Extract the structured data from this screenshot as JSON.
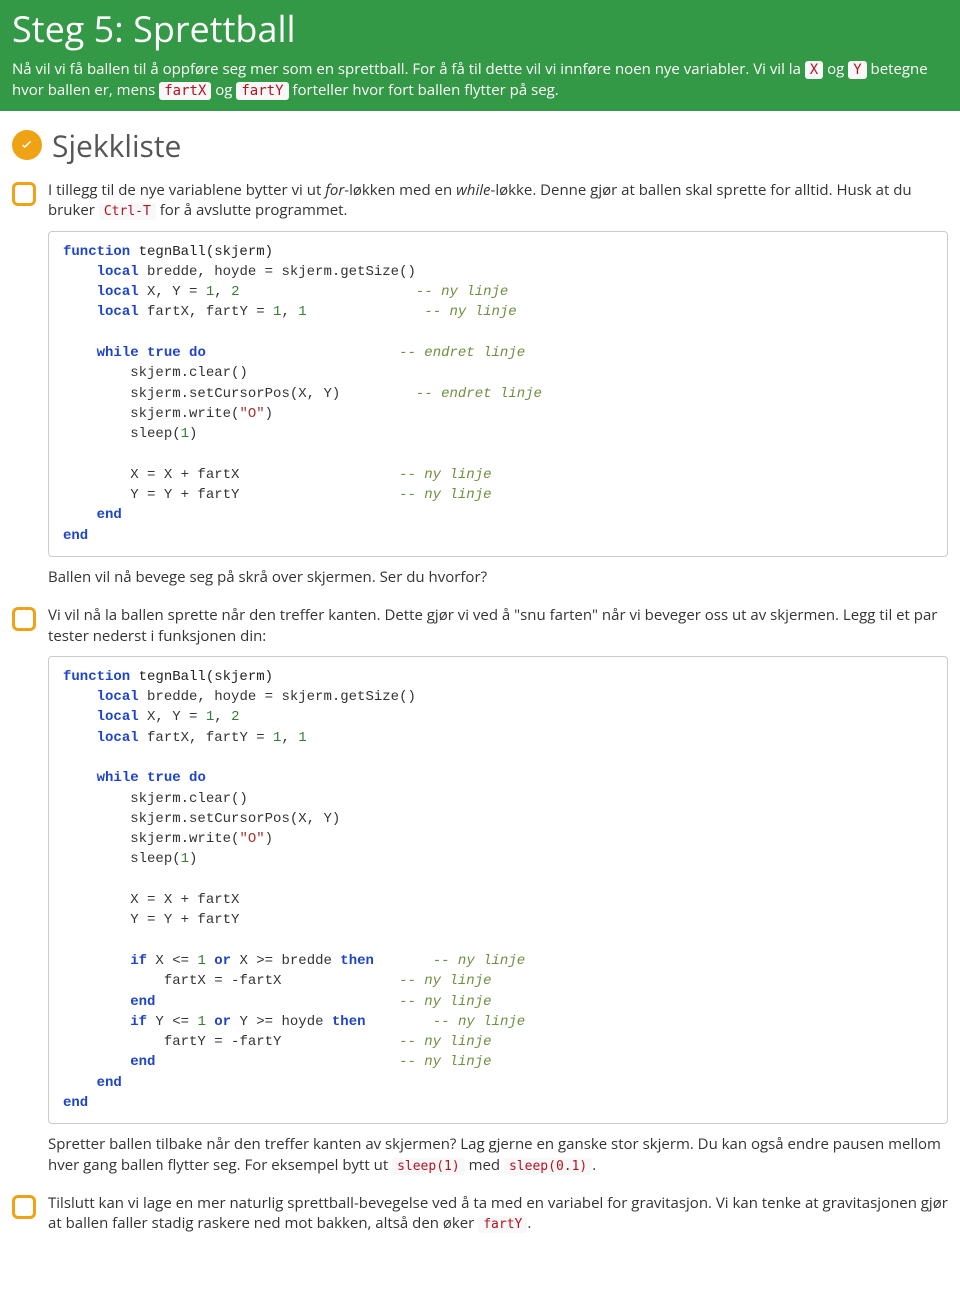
{
  "header": {
    "title": "Steg 5: Sprettball",
    "intro_parts": {
      "p1": "Nå vil vi få ballen til å oppføre seg mer som en sprettball. For å få til dette vil vi innføre noen nye variabler. Vi vil la ",
      "c1": "X",
      "p2": " og ",
      "c2": "Y",
      "p3": " betegne hvor ballen er, mens ",
      "c3": "fartX",
      "p4": " og ",
      "c4": "fartY",
      "p5": " forteller hvor fort ballen flytter på seg."
    }
  },
  "section": {
    "title": "Sjekkliste"
  },
  "item1": {
    "text_parts": {
      "p1": "I tillegg til de nye variablene bytter vi ut ",
      "i1": "for",
      "p2": "-løkken med en ",
      "i2": "while",
      "p3": "-løkke. Denne gjør at ballen skal sprette for alltid. Husk at du bruker ",
      "c1": "Ctrl-T",
      "p4": " for å avslutte programmet."
    },
    "followup": "Ballen vil nå bevege seg på skrå over skjermen. Ser du hvorfor?"
  },
  "item2": {
    "text": "Vi vil nå la ballen sprette når den treffer kanten. Dette gjør vi ved å \"snu farten\" når vi beveger oss ut av skjermen. Legg til et par tester nederst i funksjonen din:",
    "followup_parts": {
      "p1": "Spretter ballen tilbake når den treffer kanten av skjermen? Lag gjerne en ganske stor skjerm. Du kan også endre pausen mellom hver gang ballen flytter seg. For eksempel bytt ut ",
      "c1": "sleep(1)",
      "p2": " med ",
      "c2": "sleep(0.1)",
      "p3": "."
    }
  },
  "item3": {
    "text_parts": {
      "p1": "Tilslutt kan vi lage en mer naturlig sprettball-bevegelse ved å ta med en variabel for gravitasjon. Vi kan tenke at gravitasjonen gjør at ballen faller stadig raskere ned mot bakken, altså den øker ",
      "c1": "fartY",
      "p2": "."
    }
  },
  "code1": {
    "tokens": {
      "kw_function": "function",
      "fn_name": " tegnBall(skjerm)",
      "kw_local1": "local",
      "r1": " bredde, hoyde = skjerm.getSize()",
      "kw_local2": "local",
      "r2a": " X, Y = ",
      "n1": "1",
      "comma1": ", ",
      "n2": "2",
      "c_ny1": "-- ny linje",
      "kw_local3": "local",
      "r3a": " fartX, fartY = ",
      "n3": "1",
      "comma2": ", ",
      "n4": "1",
      "c_ny2": "-- ny linje",
      "kw_while": "while",
      "kw_true": "true",
      "kw_do": "do",
      "c_endret1": "-- endret linje",
      "l_clear": "skjerm.clear()",
      "l_setcur": "skjerm.setCursorPos(X, Y)",
      "c_endret2": "-- endret linje",
      "l_write_a": "skjerm.write(",
      "s_o": "\"O\"",
      "l_write_b": ")",
      "l_sleep_a": "sleep(",
      "n_sleep": "1",
      "l_sleep_b": ")",
      "l_xx": "X = X + fartX",
      "c_ny3": "-- ny linje",
      "l_yy": "Y = Y + fartY",
      "c_ny4": "-- ny linje",
      "kw_end1": "end",
      "kw_end2": "end"
    }
  },
  "code2": {
    "tokens": {
      "kw_function": "function",
      "fn_name": " tegnBall(skjerm)",
      "kw_local1": "local",
      "r1": " bredde, hoyde = skjerm.getSize()",
      "kw_local2": "local",
      "r2a": " X, Y = ",
      "n1": "1",
      "comma1": ", ",
      "n2": "2",
      "kw_local3": "local",
      "r3a": " fartX, fartY = ",
      "n3": "1",
      "comma2": ", ",
      "n4": "1",
      "kw_while": "while",
      "kw_true": "true",
      "kw_do": "do",
      "l_clear": "skjerm.clear()",
      "l_setcur": "skjerm.setCursorPos(X, Y)",
      "l_write_a": "skjerm.write(",
      "s_o": "\"O\"",
      "l_write_b": ")",
      "l_sleep_a": "sleep(",
      "n_sleep": "1",
      "l_sleep_b": ")",
      "l_xx": "X = X + fartX",
      "l_yy": "Y = Y + fartY",
      "kw_if1": "if",
      "cond1a": " X <= ",
      "n_c1": "1",
      "kw_or1": "or",
      "cond1b": " X >= bredde ",
      "kw_then1": "then",
      "c_ny1": "-- ny linje",
      "l_negx": "fartX = -fartX",
      "c_ny2": "-- ny linje",
      "kw_end_if1": "end",
      "c_ny3": "-- ny linje",
      "kw_if2": "if",
      "cond2a": " Y <= ",
      "n_c2": "1",
      "kw_or2": "or",
      "cond2b": " Y >= hoyde ",
      "kw_then2": "then",
      "c_ny4": "-- ny linje",
      "l_negy": "fartY = -fartY",
      "c_ny5": "-- ny linje",
      "kw_end_if2": "end",
      "c_ny6": "-- ny linje",
      "kw_end1": "end",
      "kw_end2": "end"
    }
  }
}
